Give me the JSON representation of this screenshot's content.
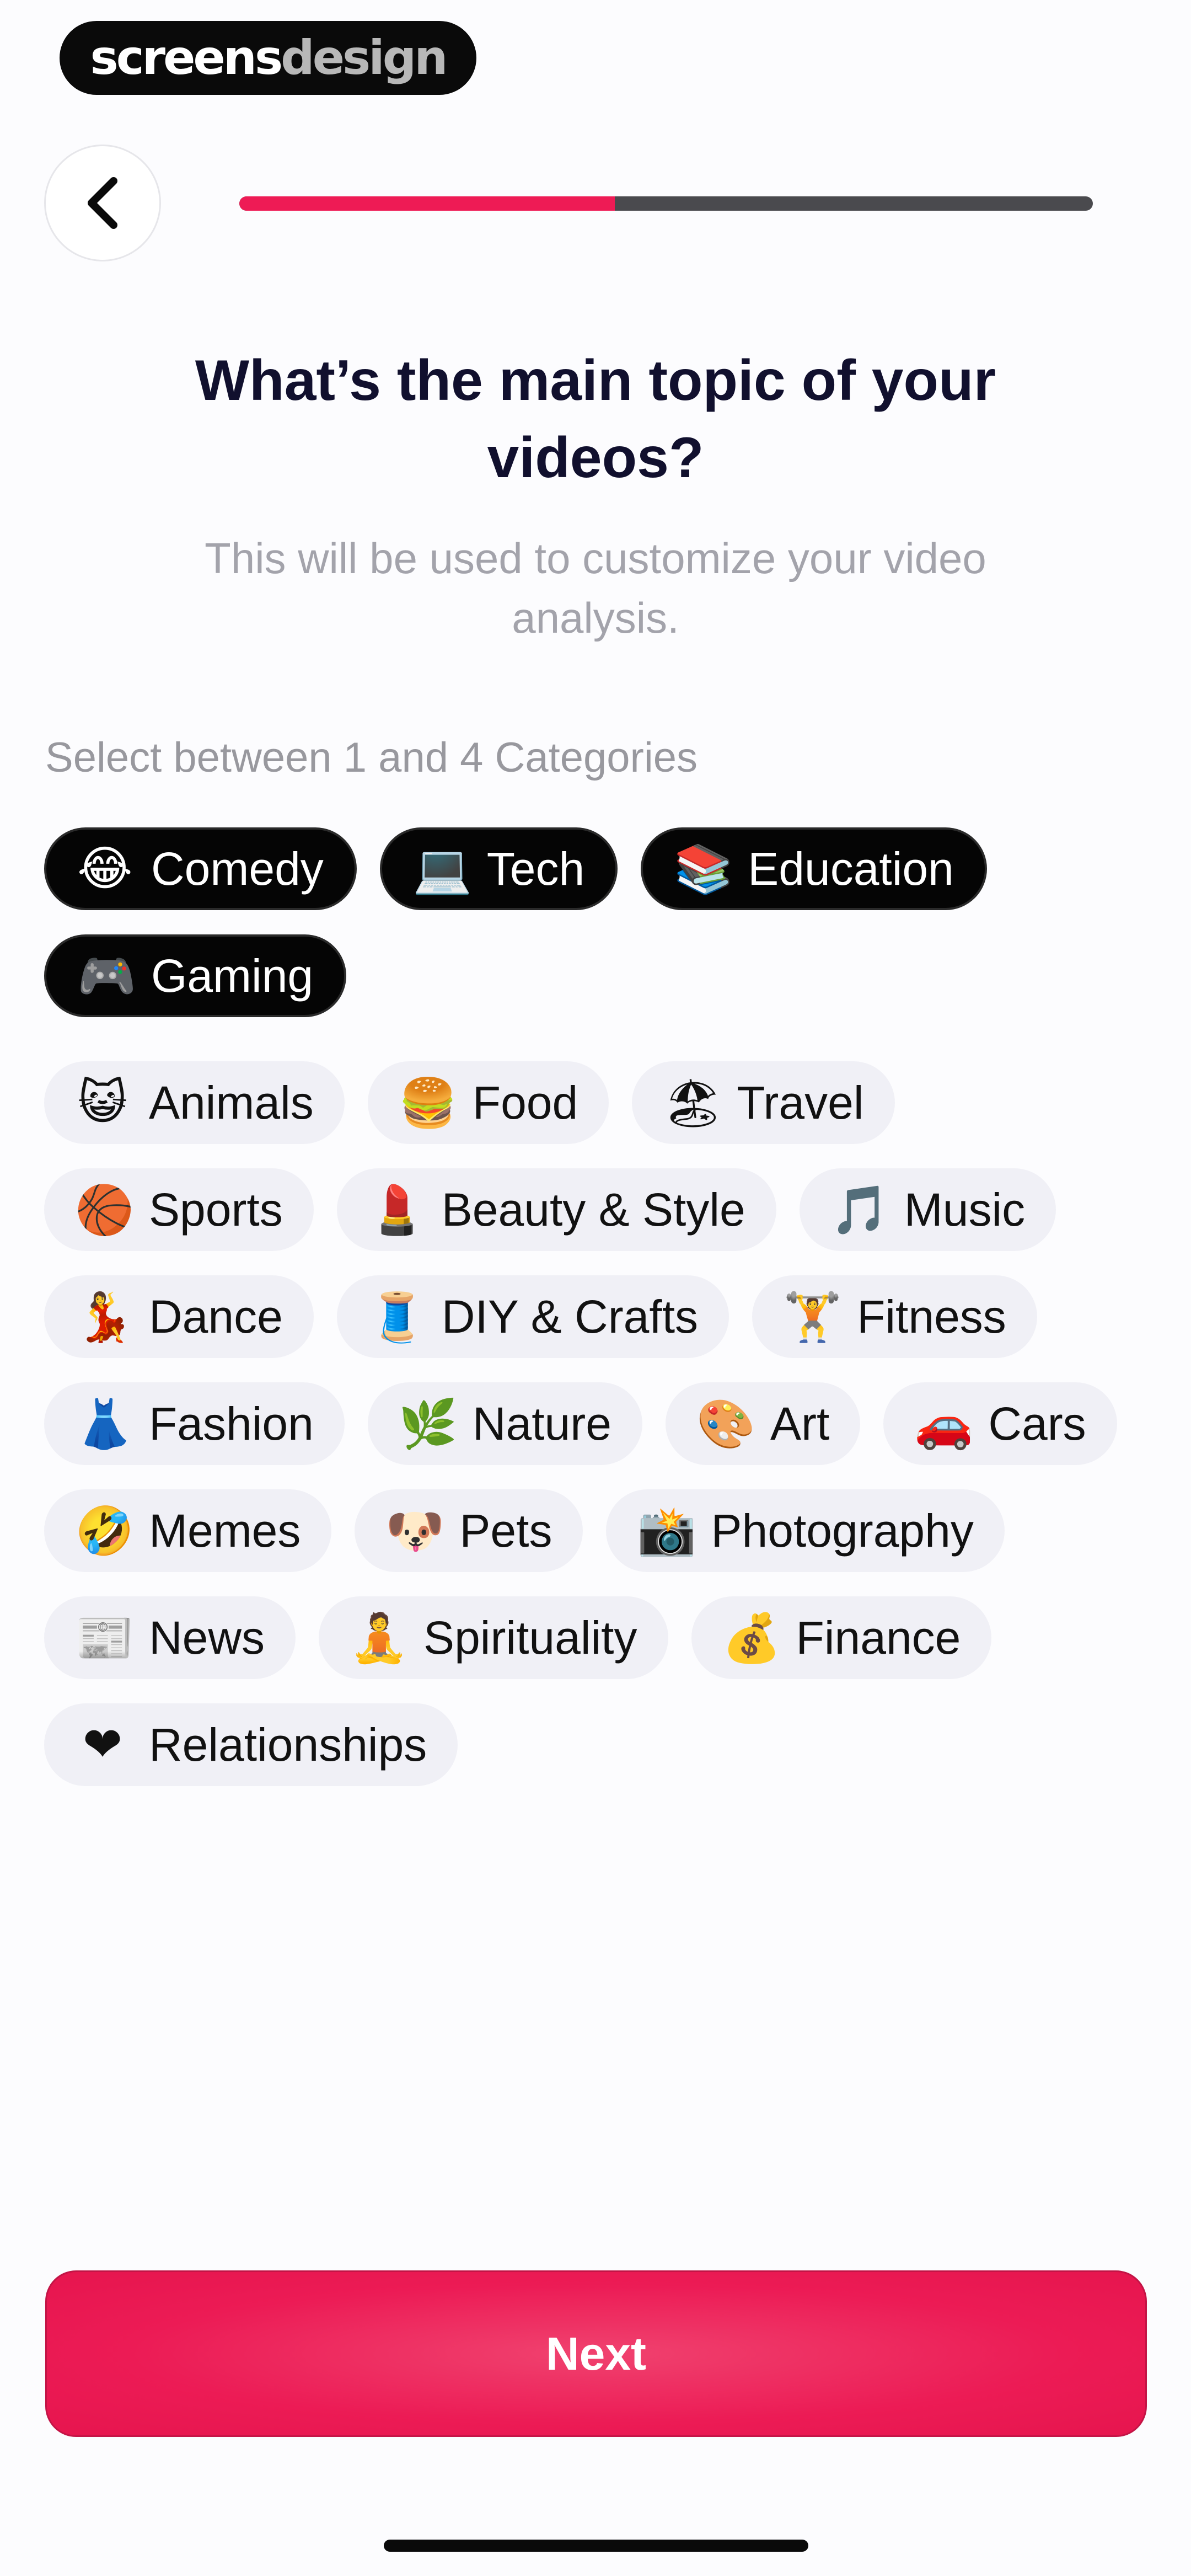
{
  "watermark": {
    "part1": "screens",
    "part2": "design"
  },
  "header": {
    "back_icon": "chevron-left-icon",
    "progress": 0.44
  },
  "title": "What’s the main topic of your videos?",
  "subtitle": "This will be used to customize your video analysis.",
  "hint": "Select between 1 and 4 Categories",
  "selected_categories": [
    {
      "emoji": "😂",
      "label": "Comedy"
    },
    {
      "emoji": "💻",
      "label": "Tech"
    },
    {
      "emoji": "📚",
      "label": "Education"
    },
    {
      "emoji": "🎮",
      "label": "Gaming"
    }
  ],
  "categories": [
    {
      "emoji": "😺",
      "label": "Animals"
    },
    {
      "emoji": "🍔",
      "label": "Food"
    },
    {
      "emoji": "🏖",
      "label": "Travel"
    },
    {
      "emoji": "🏀",
      "label": "Sports"
    },
    {
      "emoji": "💄",
      "label": "Beauty & Style"
    },
    {
      "emoji": "🎵",
      "label": "Music"
    },
    {
      "emoji": "💃",
      "label": "Dance"
    },
    {
      "emoji": "🧵",
      "label": "DIY & Crafts"
    },
    {
      "emoji": "🏋",
      "label": "Fitness"
    },
    {
      "emoji": "👗",
      "label": "Fashion"
    },
    {
      "emoji": "🌿",
      "label": "Nature"
    },
    {
      "emoji": "🎨",
      "label": "Art"
    },
    {
      "emoji": "🚗",
      "label": "Cars"
    },
    {
      "emoji": "🤣",
      "label": "Memes"
    },
    {
      "emoji": "🐶",
      "label": "Pets"
    },
    {
      "emoji": "📸",
      "label": "Photography"
    },
    {
      "emoji": "📰",
      "label": "News"
    },
    {
      "emoji": "🧘",
      "label": "Spirituality"
    },
    {
      "emoji": "💰",
      "label": "Finance"
    },
    {
      "emoji": "❤",
      "label": "Relationships"
    }
  ],
  "next_label": "Next",
  "colors": {
    "accent": "#ee1b55",
    "progress_track": "#4a4a4e",
    "chip_selected_bg": "#050505",
    "chip_unselected_bg": "#f0f0f6"
  }
}
